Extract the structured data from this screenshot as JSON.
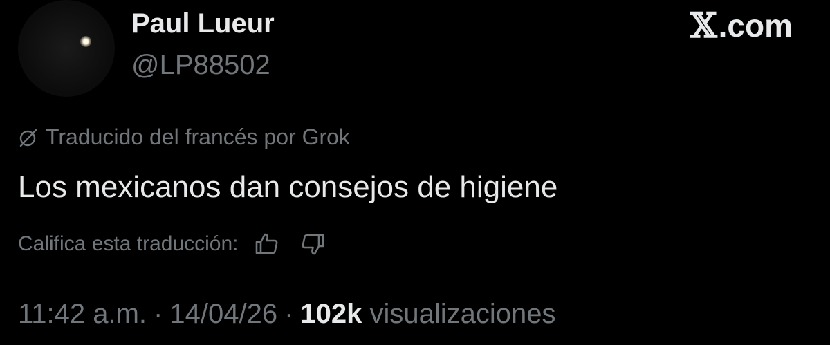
{
  "author": {
    "display_name": "Paul Lueur",
    "handle": "@LP88502",
    "avatar_icon": "night-sky-star-avatar"
  },
  "brand": {
    "glyph": "𝕏",
    "domain": ".com"
  },
  "translation": {
    "icon": "grok-icon",
    "note": "Traducido del francés por Grok",
    "rate_label": "Califica esta traducción:",
    "rate_up_icon": "thumbs-up-icon",
    "rate_down_icon": "thumbs-down-icon"
  },
  "tweet": {
    "text": "Los mexicanos dan consejos de higiene"
  },
  "meta": {
    "time": "11:42 a.m.",
    "sep1": "·",
    "date": "14/04/26",
    "sep2": "·",
    "views_count": "102k",
    "views_label": "visualizaciones"
  },
  "colors": {
    "background": "#000000",
    "primary_text": "#e7e9ea",
    "secondary_text": "#71767b"
  }
}
